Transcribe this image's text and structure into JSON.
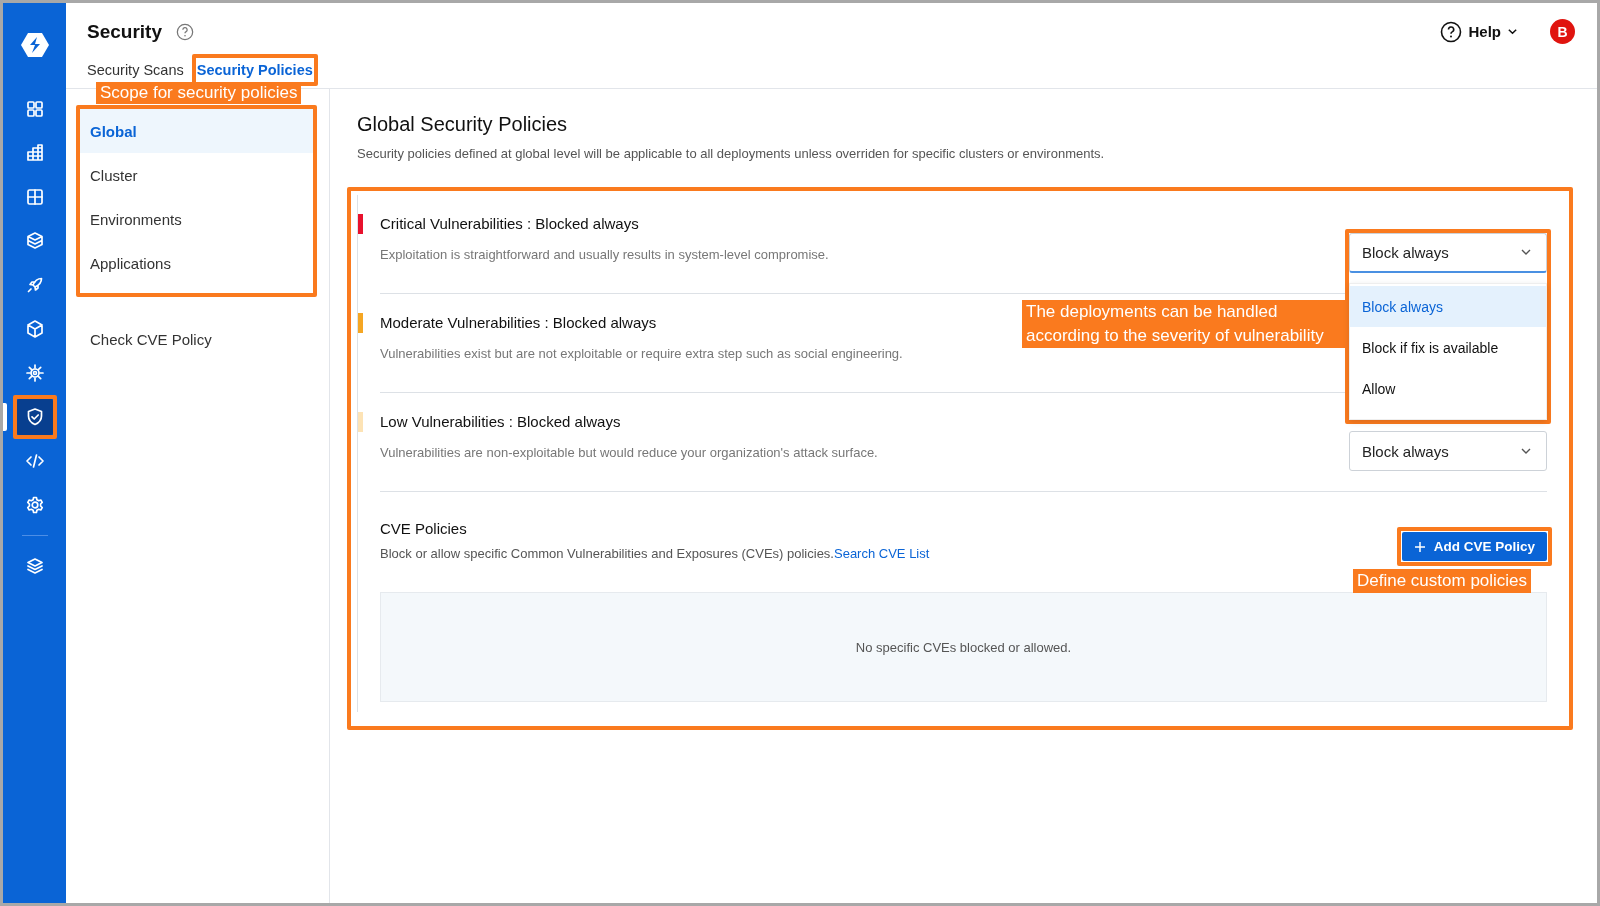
{
  "nav_rail": {
    "items": [
      {
        "selected": false
      },
      {
        "selected": false
      },
      {
        "selected": false
      },
      {
        "selected": false
      },
      {
        "selected": false
      },
      {
        "selected": false
      },
      {
        "selected": false
      },
      {
        "selected": true
      },
      {
        "selected": false
      },
      {
        "selected": false
      },
      {
        "selected": false
      }
    ]
  },
  "header": {
    "title": "Security",
    "help": "Help",
    "avatar": "B",
    "tabs": [
      {
        "label": "Security Scans",
        "selected": false
      },
      {
        "label": "Security Policies",
        "selected": true
      }
    ]
  },
  "scope_nav": {
    "items": [
      {
        "label": "Global",
        "selected": true
      },
      {
        "label": "Cluster",
        "selected": false
      },
      {
        "label": "Environments",
        "selected": false
      },
      {
        "label": "Applications",
        "selected": false
      }
    ],
    "link": "Check CVE Policy"
  },
  "main": {
    "title": "Global Security Policies",
    "description": "Security policies defined at global level will be applicable to all deployments unless overriden for specific clusters or environments.",
    "policies": [
      {
        "title": "Critical Vulnerabilities : Blocked always",
        "description": "Exploitation is straightforward and usually results in system-level compromise.",
        "color": "#e8112d",
        "dropdown": {
          "value": "Block always",
          "expanded": true
        }
      },
      {
        "title": "Moderate Vulnerabilities : Blocked always",
        "description": "Vulnerabilities exist but are not exploitable or require extra step such as social engineering.",
        "color": "#f5a623"
      },
      {
        "title": "Low Vulnerabilities : Blocked always",
        "description": "Vulnerabilities are non-exploitable but would reduce your organization's attack surface.",
        "color": "#fde3b5",
        "dropdown": {
          "value": "Block always",
          "expanded": false
        }
      }
    ],
    "menu_options": [
      {
        "label": "Block always",
        "selected": true
      },
      {
        "label": "Block if fix is available",
        "selected": false
      },
      {
        "label": "Allow",
        "selected": false
      }
    ],
    "cve": {
      "title": "CVE Policies",
      "description": "Block or allow specific Common Vulnerabilities and Exposures (CVEs) policies.",
      "link": "Search CVE List",
      "button": "Add CVE Policy",
      "empty_text": "No specific CVEs blocked or allowed."
    }
  },
  "annotations": [
    {
      "text": "Scope for security policies"
    },
    {
      "text": "The deployments can be handled according to the severity of vulnerability"
    },
    {
      "text": "Define custom policies"
    }
  ]
}
